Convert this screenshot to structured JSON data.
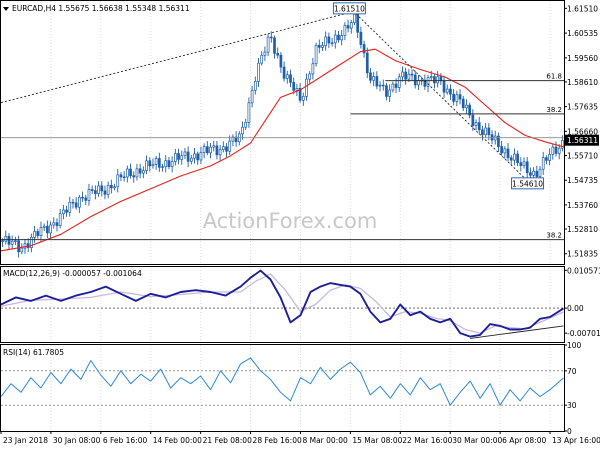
{
  "colors": {
    "background": "#ffffff",
    "candles": "#1f5fa8",
    "ma": "#e8231c",
    "macd_main": "#1b1f9a",
    "macd_signal": "#c8b8df",
    "rsi": "#2a8ad8",
    "fib": "#333333",
    "trend": "#222222",
    "price_box": "#1f55a8"
  },
  "chart_data": [
    {
      "type": "candlestick",
      "panel": "price",
      "title": "EURCAD,H4  1.55675 1.56638 1.55348 1.56311",
      "symbol": "EURCAD",
      "timeframe": "H4",
      "ohlc": {
        "open": 1.55675,
        "high": 1.56638,
        "low": 1.55348,
        "close": 1.56311
      },
      "ylim": [
        1.5143,
        1.618
      ],
      "y_ticks": [
        1.6151,
        1.60535,
        1.5956,
        1.5861,
        1.57635,
        1.5666,
        1.5571,
        1.54735,
        1.5376,
        1.5281,
        1.51835
      ],
      "y_tick_labels": [
        "1.61510",
        "1.60535",
        "1.59560",
        "1.58610",
        "1.57635",
        "1.56660",
        "1.55710",
        "1.54735",
        "1.53760",
        "1.52810",
        "1.51835"
      ],
      "x_ticks": [
        0,
        1,
        2,
        3,
        4,
        5,
        6,
        7,
        8,
        9,
        10
      ],
      "x_tick_labels": [
        "23 Jan 2018",
        "30 Jan 08:00",
        "6 Feb 16:00",
        "14 Feb 00:00",
        "21 Feb 08:00",
        "28 Feb 16:00",
        "8 Mar 00:00",
        "15 Mar 08:00",
        "22 Mar 16:00",
        "30 Mar 00:00",
        "6 Apr 08:00",
        "13 Apr 16:00"
      ],
      "x_range": [
        0,
        11.28
      ],
      "candle_count": 176,
      "series": [
        {
          "kind": "close-path",
          "x": [
            0,
            0.4,
            0.8,
            1.2,
            1.6,
            2.0,
            2.4,
            2.8,
            3.2,
            3.6,
            4.0,
            4.4,
            4.8,
            5.1,
            5.4,
            5.7,
            6.0,
            6.3,
            6.6,
            6.9,
            7.1,
            7.4,
            7.7,
            8.0,
            8.4,
            8.8,
            9.2,
            9.5,
            9.8,
            10.1,
            10.4,
            10.7,
            11.0,
            11.27
          ],
          "y": [
            1.5235,
            1.521,
            1.527,
            1.533,
            1.541,
            1.543,
            1.548,
            1.552,
            1.554,
            1.556,
            1.558,
            1.56,
            1.564,
            1.589,
            1.604,
            1.588,
            1.579,
            1.598,
            1.603,
            1.606,
            1.611,
            1.587,
            1.582,
            1.588,
            1.587,
            1.586,
            1.578,
            1.57,
            1.564,
            1.559,
            1.553,
            1.55,
            1.557,
            1.5631
          ]
        },
        {
          "kind": "ma",
          "x": [
            0,
            0.6,
            1.2,
            1.8,
            2.4,
            3.0,
            3.6,
            4.2,
            4.6,
            5.0,
            5.3,
            5.6,
            6.0,
            6.4,
            6.8,
            7.2,
            7.5,
            7.9,
            8.4,
            8.9,
            9.3,
            9.7,
            10.1,
            10.5,
            10.9,
            11.27
          ],
          "y": [
            1.5195,
            1.5215,
            1.526,
            1.533,
            1.539,
            1.544,
            1.549,
            1.553,
            1.557,
            1.562,
            1.571,
            1.58,
            1.583,
            1.588,
            1.593,
            1.598,
            1.599,
            1.5945,
            1.591,
            1.588,
            1.584,
            1.577,
            1.57,
            1.565,
            1.5625,
            1.5605
          ]
        }
      ],
      "fib_lines": [
        {
          "label": "61.8",
          "value": 1.5866,
          "x_start": 7.7
        },
        {
          "label": "38.2",
          "value": 1.5735,
          "x_start": 7.0
        },
        {
          "label": "38.2",
          "value": 1.5239,
          "x_start": 0.0
        }
      ],
      "hline": {
        "value": 1.5641
      },
      "trendlines": [
        {
          "style": "dashed",
          "points": [
            [
              0,
              1.5779
            ],
            [
              6.9,
              1.613
            ]
          ]
        },
        {
          "style": "dashed",
          "points": [
            [
              7.0,
              1.6151
            ],
            [
              10.6,
              1.5461
            ]
          ]
        }
      ],
      "annotations": [
        {
          "text": "1.61510",
          "x": 6.98,
          "y": 1.6151
        },
        {
          "text": "1.54610",
          "x": 10.55,
          "y": 1.5461
        }
      ],
      "current_price": "1.56311",
      "watermark": "ActionForex.com"
    },
    {
      "type": "line",
      "panel": "macd",
      "title": "MACD(12,26,9) -0.000057 -0.001064",
      "indicator": "MACD(12,26,9)",
      "main": -5.7e-05,
      "signal": -0.001064,
      "ylim": [
        -0.0095,
        0.0115
      ],
      "y_ticks": [
        0.010571,
        0.0,
        -0.007014
      ],
      "y_tick_labels": [
        "0.010571",
        "0.00",
        "-0.007014"
      ],
      "series": [
        {
          "name": "main",
          "x": [
            0,
            0.3,
            0.6,
            0.9,
            1.2,
            1.5,
            1.8,
            2.1,
            2.4,
            2.7,
            3.0,
            3.3,
            3.6,
            3.9,
            4.2,
            4.5,
            4.8,
            5.0,
            5.2,
            5.4,
            5.6,
            5.8,
            6.0,
            6.2,
            6.4,
            6.6,
            6.8,
            7.0,
            7.2,
            7.4,
            7.6,
            7.8,
            8.0,
            8.2,
            8.4,
            8.6,
            8.8,
            9.0,
            9.2,
            9.4,
            9.6,
            9.8,
            10.0,
            10.2,
            10.4,
            10.6,
            10.8,
            11.0,
            11.27
          ],
          "y": [
            0.001,
            0.003,
            0.002,
            0.0035,
            0.002,
            0.0035,
            0.0045,
            0.006,
            0.004,
            0.002,
            0.004,
            0.003,
            0.0045,
            0.005,
            0.0045,
            0.0035,
            0.006,
            0.0085,
            0.0105,
            0.008,
            0.003,
            -0.004,
            -0.002,
            0.0045,
            0.006,
            0.007,
            0.0065,
            0.006,
            0.004,
            -0.001,
            -0.004,
            -0.003,
            0.001,
            -0.002,
            -0.001,
            -0.003,
            -0.004,
            -0.003,
            -0.007,
            -0.008,
            -0.0075,
            -0.0045,
            -0.005,
            -0.006,
            -0.006,
            -0.0055,
            -0.003,
            -0.0025,
            -0.0001
          ]
        },
        {
          "name": "signal",
          "x": [
            0,
            0.6,
            1.2,
            1.8,
            2.4,
            3.0,
            3.6,
            4.2,
            4.8,
            5.1,
            5.4,
            5.7,
            6.0,
            6.3,
            6.6,
            6.9,
            7.2,
            7.5,
            7.8,
            8.1,
            8.4,
            8.7,
            9.0,
            9.3,
            9.6,
            9.9,
            10.2,
            10.5,
            10.8,
            11.27
          ],
          "y": [
            0.0005,
            0.0022,
            0.0025,
            0.003,
            0.0045,
            0.0032,
            0.0038,
            0.0045,
            0.0045,
            0.0075,
            0.0095,
            0.005,
            -0.001,
            0.001,
            0.005,
            0.0065,
            0.0055,
            0.002,
            -0.0025,
            -0.001,
            -0.0015,
            -0.0028,
            -0.0035,
            -0.006,
            -0.007,
            -0.005,
            -0.0055,
            -0.0058,
            -0.004,
            -0.0011
          ]
        }
      ],
      "hline": {
        "value": 0.0
      },
      "trendline": {
        "points": [
          [
            9.4,
            -0.0085
          ],
          [
            11.27,
            -0.005
          ]
        ]
      }
    },
    {
      "type": "line",
      "panel": "rsi",
      "title": "RSI(14) 61.7805",
      "indicator": "RSI(14)",
      "value": 61.7805,
      "ylim": [
        0,
        100
      ],
      "y_ticks": [
        100,
        70,
        30,
        0
      ],
      "y_tick_labels": [
        "100",
        "70",
        "30",
        "0"
      ],
      "levels": [
        70,
        30
      ],
      "series": [
        {
          "name": "RSI(14)",
          "x": [
            0,
            0.2,
            0.4,
            0.6,
            0.8,
            1.0,
            1.2,
            1.4,
            1.6,
            1.8,
            2.0,
            2.2,
            2.4,
            2.6,
            2.8,
            3.0,
            3.2,
            3.4,
            3.6,
            3.8,
            4.0,
            4.2,
            4.4,
            4.6,
            4.8,
            5.0,
            5.2,
            5.4,
            5.6,
            5.8,
            6.0,
            6.2,
            6.4,
            6.6,
            6.8,
            7.0,
            7.2,
            7.4,
            7.6,
            7.8,
            8.0,
            8.2,
            8.4,
            8.6,
            8.8,
            9.0,
            9.2,
            9.4,
            9.6,
            9.8,
            10.0,
            10.2,
            10.4,
            10.6,
            10.8,
            11.0,
            11.27
          ],
          "y": [
            40,
            55,
            45,
            62,
            50,
            68,
            55,
            72,
            60,
            82,
            65,
            52,
            70,
            55,
            66,
            58,
            72,
            50,
            62,
            55,
            64,
            48,
            70,
            56,
            78,
            85,
            70,
            60,
            45,
            35,
            62,
            55,
            74,
            60,
            72,
            80,
            68,
            42,
            52,
            38,
            55,
            42,
            62,
            48,
            55,
            30,
            45,
            58,
            38,
            55,
            30,
            48,
            35,
            50,
            40,
            48,
            61.78
          ]
        }
      ]
    }
  ]
}
